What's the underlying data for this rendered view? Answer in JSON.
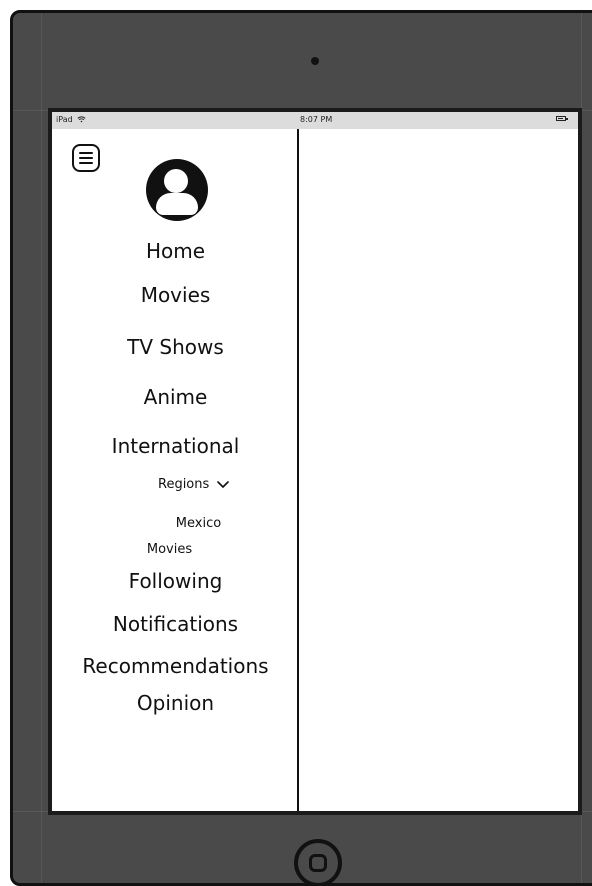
{
  "status_bar": {
    "device": "iPad",
    "time": "8:07 PM",
    "wifi_icon": "wifi-icon",
    "battery_icon": "battery-icon"
  },
  "sidebar": {
    "menu_icon": "menu-icon",
    "avatar_icon": "user-avatar-icon",
    "items": [
      {
        "label": "Home"
      },
      {
        "label": "Movies"
      },
      {
        "label": "TV Shows"
      },
      {
        "label": "Anime"
      },
      {
        "label": "International"
      },
      {
        "label": "Following"
      },
      {
        "label": "Notifications"
      },
      {
        "label": "Recommendations"
      },
      {
        "label": "Opinion"
      }
    ],
    "international": {
      "regions_label": "Regions",
      "chevron_icon": "chevron-down-icon",
      "sub_items": [
        {
          "label": "Mexico"
        },
        {
          "label": "Movies"
        }
      ]
    }
  },
  "device": {
    "camera_icon": "camera-icon",
    "home_button_icon": "home-button-icon"
  }
}
